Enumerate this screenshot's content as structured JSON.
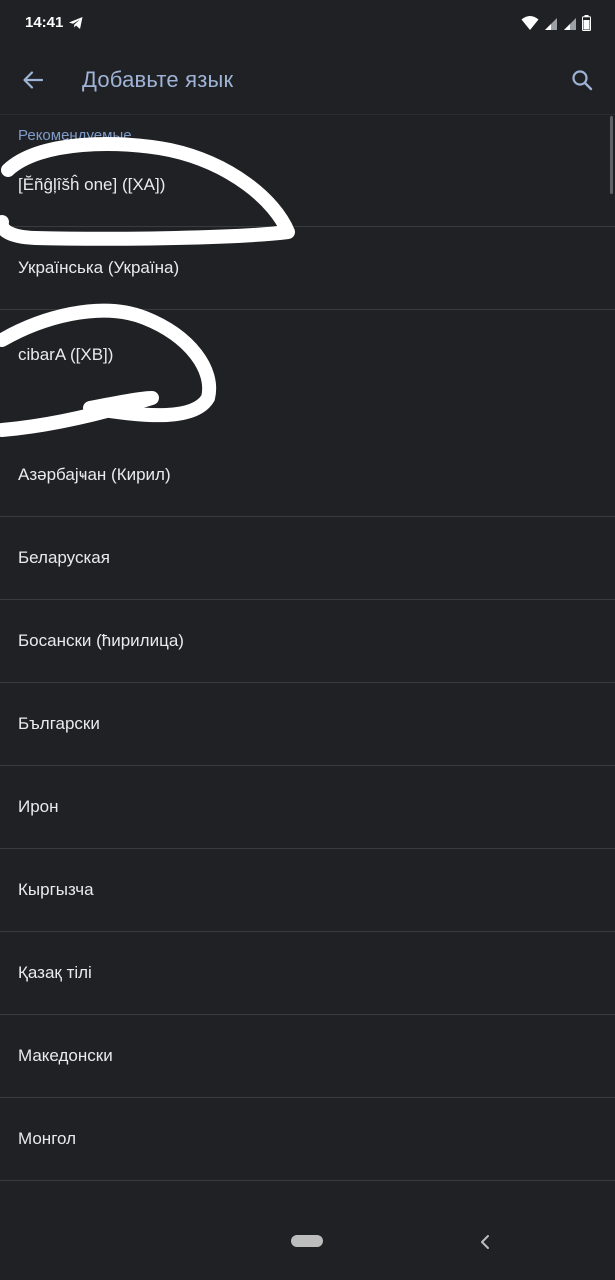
{
  "status_bar": {
    "time": "14:41",
    "icons": [
      "telegram-icon",
      "wifi-icon",
      "signal-icon",
      "signal-icon-2",
      "battery-icon"
    ]
  },
  "app_bar": {
    "title": "Добавьте язык",
    "back_icon": "arrow-back-icon",
    "search_icon": "search-icon"
  },
  "sections": {
    "suggested": {
      "header": "Рекомендуемые",
      "items": [
        "[Ĕñĝļîšĥ one] ([XA])",
        "Українська (Україна)",
        "cibarA ([XB])"
      ]
    },
    "all": {
      "items": [
        "Азәрбајҹан (Кирил)",
        "Беларуская",
        "Босански (ћирилица)",
        "Български",
        "Ирон",
        "Кыргызча",
        "Қазақ тілі",
        "Македонски",
        "Монгол"
      ]
    }
  },
  "colors": {
    "background": "#202124",
    "accent": "#9fb3d6",
    "text": "#e8eaed",
    "divider": "#3a3b3e",
    "scribble": "#ffffff"
  },
  "nav_bar": {
    "home_icon": "home-pill-icon",
    "back_icon": "nav-back-icon"
  }
}
